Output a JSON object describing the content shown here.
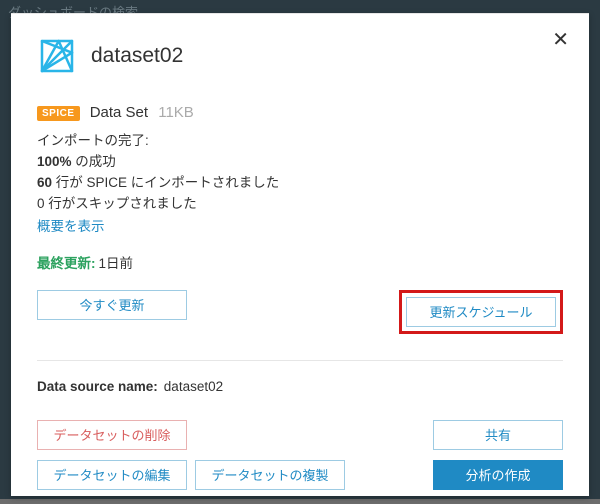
{
  "backdrop_hint": "ダッシュボードの検索",
  "title": "dataset02",
  "badge": "SPICE",
  "type_label": "Data Set",
  "size": "11KB",
  "import": {
    "heading": "インポートの完了:",
    "success_pct": "100%",
    "success_suffix": " の成功",
    "rows_n": "60",
    "rows_suffix": " 行が SPICE にインポートされました",
    "skipped_line": "0 行がスキップされました",
    "summary_link": "概要を表示"
  },
  "last_updated": {
    "label": "最終更新:",
    "value": "1日前"
  },
  "buttons": {
    "refresh_now": "今すぐ更新",
    "schedule": "更新スケジュール",
    "delete": "データセットの削除",
    "share": "共有",
    "edit": "データセットの編集",
    "duplicate": "データセットの複製",
    "create_analysis": "分析の作成"
  },
  "data_source": {
    "label": "Data source name:",
    "value": "dataset02"
  }
}
